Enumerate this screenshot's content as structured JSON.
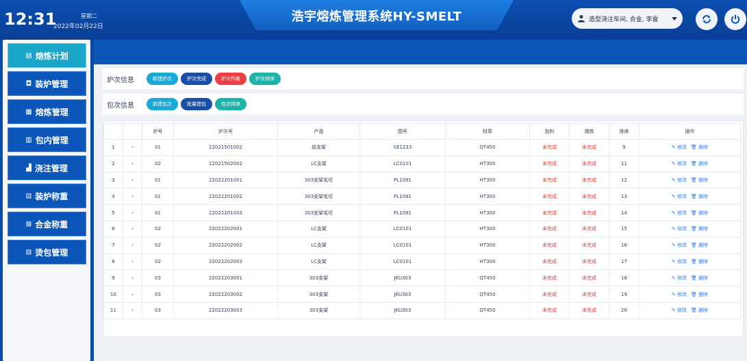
{
  "header": {
    "time": "12:31",
    "weekday": "星期二",
    "date": "2022年02月22日",
    "title": "浩宇熔炼管理系统HY-SMELT",
    "user": "造型浇注车间, 合金, 李雷"
  },
  "sidebar": {
    "items": [
      {
        "label": "熔炼计划",
        "icon": "▤"
      },
      {
        "label": "装炉管理",
        "icon": "◘"
      },
      {
        "label": "熔炼管理",
        "icon": "▦"
      },
      {
        "label": "包内管理",
        "icon": "▥"
      },
      {
        "label": "浇注管理",
        "icon": "▟"
      },
      {
        "label": "装炉称重",
        "icon": "⊡"
      },
      {
        "label": "合金称重",
        "icon": "⊞"
      },
      {
        "label": "烫包管理",
        "icon": "⊟"
      }
    ]
  },
  "toolbar": {
    "heat_label": "炉次信息",
    "heat_buttons": [
      "新建炉次",
      "炉次完成",
      "炉次作废",
      "炉次排序"
    ],
    "ladle_label": "包次信息",
    "ladle_buttons": [
      "新建包次",
      "批量建包",
      "包次排序"
    ]
  },
  "colors": {
    "cyan": "#1aa8d4",
    "navy": "#1a4fa8",
    "red": "#ee3e45",
    "teal": "#1eb3a8"
  },
  "table": {
    "headers": [
      "",
      "",
      "炉号",
      "炉次号",
      "产品",
      "图号",
      "材质",
      "加料",
      "熔炼",
      "排序",
      "操作"
    ],
    "edit_label": "修改",
    "delete_label": "删除",
    "rows": [
      [
        "1",
        "›",
        "01",
        "22021501002",
        "前支架",
        "SE1233",
        "QT450",
        "未完成",
        "未完成",
        "9"
      ],
      [
        "2",
        "›",
        "02",
        "22021502002",
        "LC支架",
        "LC0101",
        "HT300",
        "未完成",
        "未完成",
        "11"
      ],
      [
        "3",
        "›",
        "01",
        "22022201001",
        "303支架毛坯",
        "PL1091",
        "HT300",
        "未完成",
        "未完成",
        "12"
      ],
      [
        "4",
        "›",
        "01",
        "22022201002",
        "303支架毛坯",
        "PL1091",
        "HT300",
        "未完成",
        "未完成",
        "13"
      ],
      [
        "5",
        "›",
        "01",
        "22022201003",
        "303支架毛坯",
        "PL1091",
        "HT300",
        "未完成",
        "未完成",
        "14"
      ],
      [
        "6",
        "›",
        "02",
        "22022202001",
        "LC支架",
        "LC0101",
        "HT300",
        "未完成",
        "未完成",
        "15"
      ],
      [
        "7",
        "›",
        "02",
        "22022202002",
        "LC支架",
        "LC0101",
        "HT300",
        "未完成",
        "未完成",
        "16"
      ],
      [
        "8",
        "›",
        "02",
        "22022202003",
        "LC支架",
        "LC0101",
        "HT300",
        "未完成",
        "未完成",
        "17"
      ],
      [
        "9",
        "›",
        "03",
        "22022203001",
        "303支架",
        "JKU303",
        "QT450",
        "未完成",
        "未完成",
        "18"
      ],
      [
        "10",
        "›",
        "03",
        "22022203002",
        "303支架",
        "JKU303",
        "QT450",
        "未完成",
        "未完成",
        "19"
      ],
      [
        "11",
        "›",
        "03",
        "22022203003",
        "303支架",
        "JKU303",
        "QT450",
        "未完成",
        "未完成",
        "20"
      ]
    ]
  }
}
